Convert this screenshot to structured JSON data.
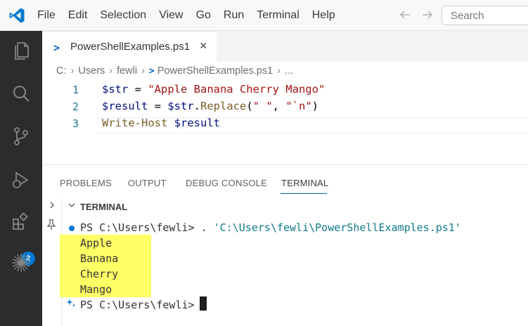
{
  "menu": [
    "File",
    "Edit",
    "Selection",
    "View",
    "Go",
    "Run",
    "Terminal",
    "Help"
  ],
  "search": {
    "placeholder": "Search"
  },
  "activity": {
    "extensions_badge": "2"
  },
  "tab": {
    "icon_glyph": ">_",
    "label": "PowerShellExamples.ps1",
    "close": "×"
  },
  "breadcrumb": {
    "drive": "C:",
    "users": "Users",
    "user": "fewli",
    "file": "PowerShellExamples.ps1",
    "more": "..."
  },
  "editor": {
    "lines": [
      {
        "num": "1",
        "var": "$str",
        "op": " = ",
        "str": "\"Apple Banana Cherry Mango\""
      },
      {
        "num": "2",
        "var": "$result",
        "op": " = ",
        "var2": "$str",
        "dot": ".",
        "method": "Replace",
        "paren_open": "(",
        "arg1": "\" \"",
        "comma": ", ",
        "arg2": "\"`n\"",
        "paren_close": ")"
      },
      {
        "num": "3",
        "cmd": "Write-Host",
        "space": " ",
        "var": "$result"
      }
    ]
  },
  "panel": {
    "tabs": [
      "PROBLEMS",
      "OUTPUT",
      "DEBUG CONSOLE",
      "TERMINAL"
    ],
    "terminal_title": "TERMINAL",
    "command_prompt": "PS C:\\Users\\fewli> . ",
    "command_path": "'C:\\Users\\fewli\\PowerShellExamples.ps1'",
    "output": [
      "Apple",
      "Banana",
      "Cherry",
      "Mango"
    ],
    "final_prompt": "PS C:\\Users\\fewli>"
  },
  "colors": {
    "accent": "#005fb8",
    "highlight": "#ffff66",
    "activity_bg": "#2c2c2c"
  }
}
